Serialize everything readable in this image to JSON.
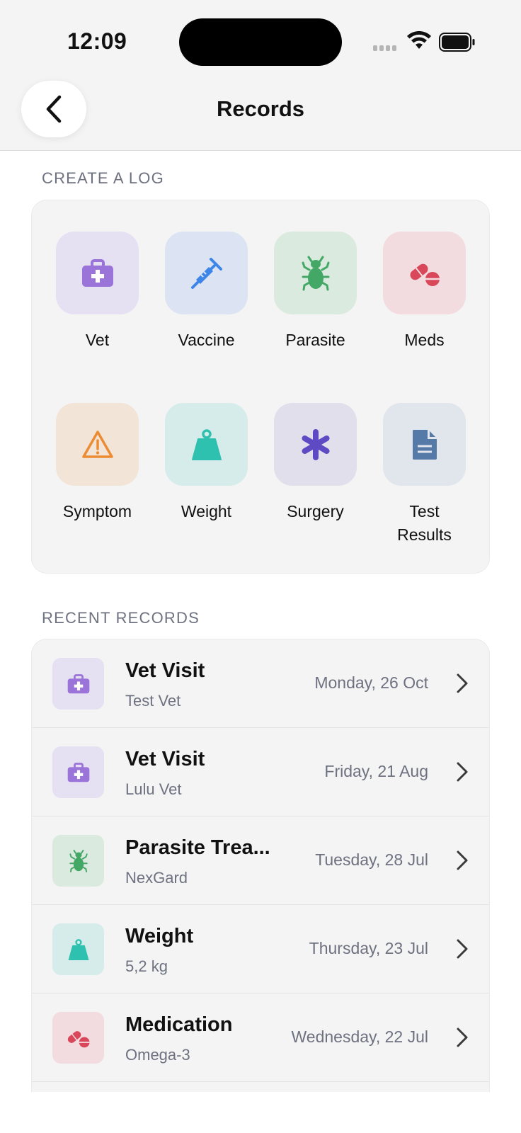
{
  "status_bar": {
    "time": "12:09"
  },
  "header": {
    "title": "Records"
  },
  "create_section": {
    "label": "CREATE A LOG",
    "tiles": [
      {
        "label": "Vet",
        "icon": "medical-bag-icon",
        "bg": "#e6e0f3",
        "color": "#9b74d9"
      },
      {
        "label": "Vaccine",
        "icon": "syringe-icon",
        "bg": "#dce4f4",
        "color": "#3d86e8"
      },
      {
        "label": "Parasite",
        "icon": "bug-icon",
        "bg": "#dbeadf",
        "color": "#43a765"
      },
      {
        "label": "Meds",
        "icon": "pills-icon",
        "bg": "#f3dcdf",
        "color": "#d9475a"
      },
      {
        "label": "Symptom",
        "icon": "warning-icon",
        "bg": "#f3e4d8",
        "color": "#ec8c32"
      },
      {
        "label": "Weight",
        "icon": "weight-icon",
        "bg": "#d5ecea",
        "color": "#2fc1b0"
      },
      {
        "label": "Surgery",
        "icon": "asterisk-icon",
        "bg": "#e1dfec",
        "color": "#5e4bc4"
      },
      {
        "label": "Test\nResults",
        "icon": "document-icon",
        "bg": "#e1e5ec",
        "color": "#557aa8"
      }
    ]
  },
  "recent_section": {
    "label": "RECENT RECORDS",
    "rows": [
      {
        "title": "Vet Visit",
        "subtitle": "Test Vet",
        "date": "Monday, 26 Oct",
        "icon": "medical-bag-icon",
        "bg": "#e6e0f3",
        "color": "#9b74d9"
      },
      {
        "title": "Vet Visit",
        "subtitle": "Lulu Vet",
        "date": "Friday, 21 Aug",
        "icon": "medical-bag-icon",
        "bg": "#e6e0f3",
        "color": "#9b74d9"
      },
      {
        "title": "Parasite Trea...",
        "subtitle": "NexGard",
        "date": "Tuesday, 28 Jul",
        "icon": "bug-icon",
        "bg": "#dbeadf",
        "color": "#43a765"
      },
      {
        "title": "Weight",
        "subtitle": "5,2 kg",
        "date": "Thursday, 23 Jul",
        "icon": "weight-icon",
        "bg": "#d5ecea",
        "color": "#2fc1b0"
      },
      {
        "title": "Medication",
        "subtitle": "Omega-3",
        "date": "Wednesday, 22 Jul",
        "icon": "pills-icon",
        "bg": "#f3dcdf",
        "color": "#d9475a"
      }
    ]
  }
}
